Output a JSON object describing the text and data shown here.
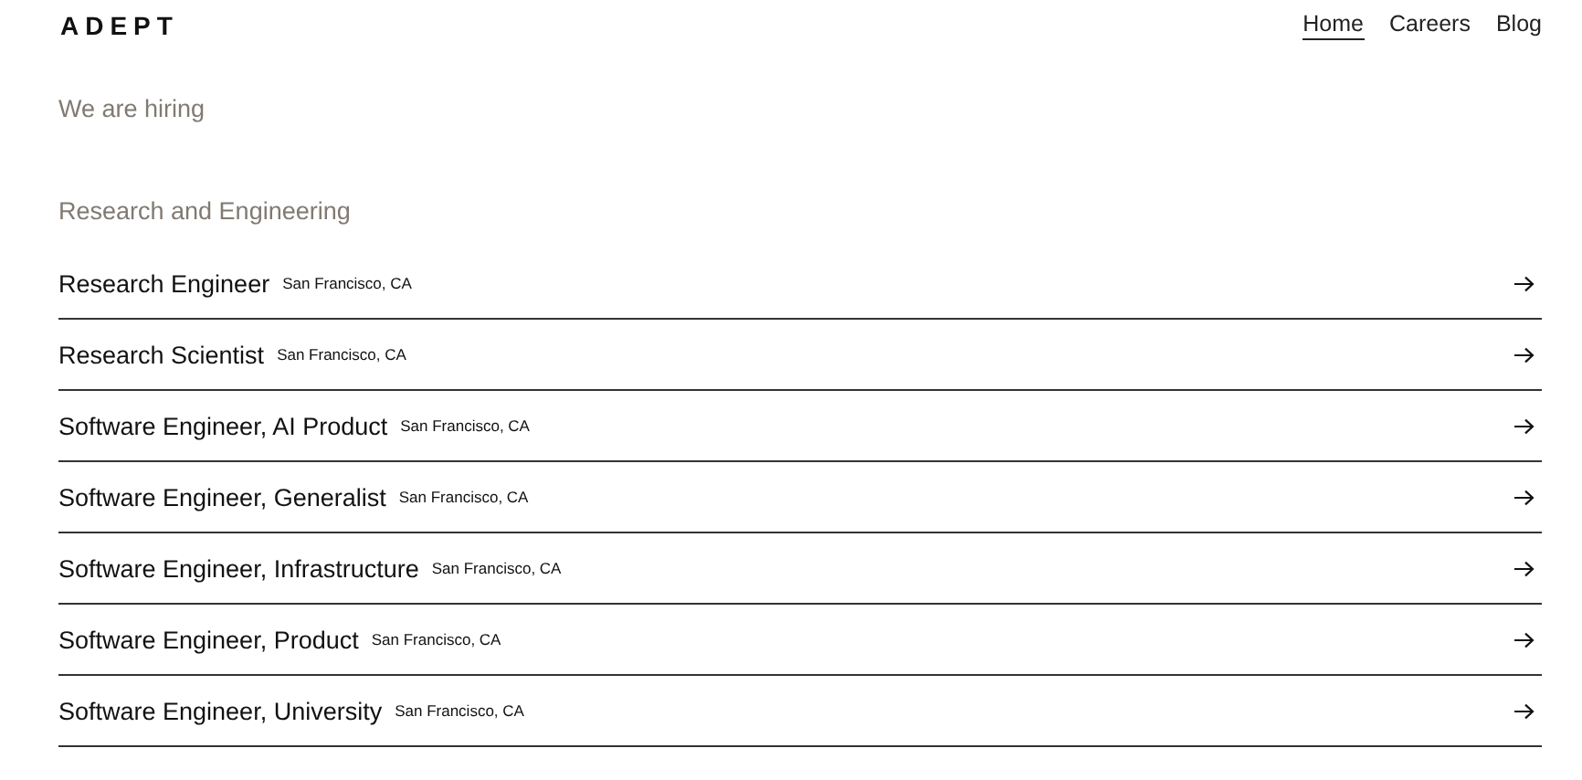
{
  "header": {
    "logo": "ADEPT",
    "nav": [
      {
        "label": "Home",
        "selected": true
      },
      {
        "label": "Careers",
        "selected": false
      },
      {
        "label": "Blog",
        "selected": false
      }
    ]
  },
  "intro": "We are hiring",
  "section": {
    "title": "Research and Engineering",
    "jobs": [
      {
        "title": "Research Engineer",
        "location": "San Francisco, CA"
      },
      {
        "title": "Research Scientist",
        "location": "San Francisco, CA"
      },
      {
        "title": "Software Engineer, AI Product",
        "location": "San Francisco, CA"
      },
      {
        "title": "Software Engineer, Generalist",
        "location": "San Francisco, CA"
      },
      {
        "title": "Software Engineer, Infrastructure",
        "location": "San Francisco, CA"
      },
      {
        "title": "Software Engineer, Product",
        "location": "San Francisco, CA"
      },
      {
        "title": "Software Engineer, University",
        "location": "San Francisco, CA"
      }
    ]
  }
}
